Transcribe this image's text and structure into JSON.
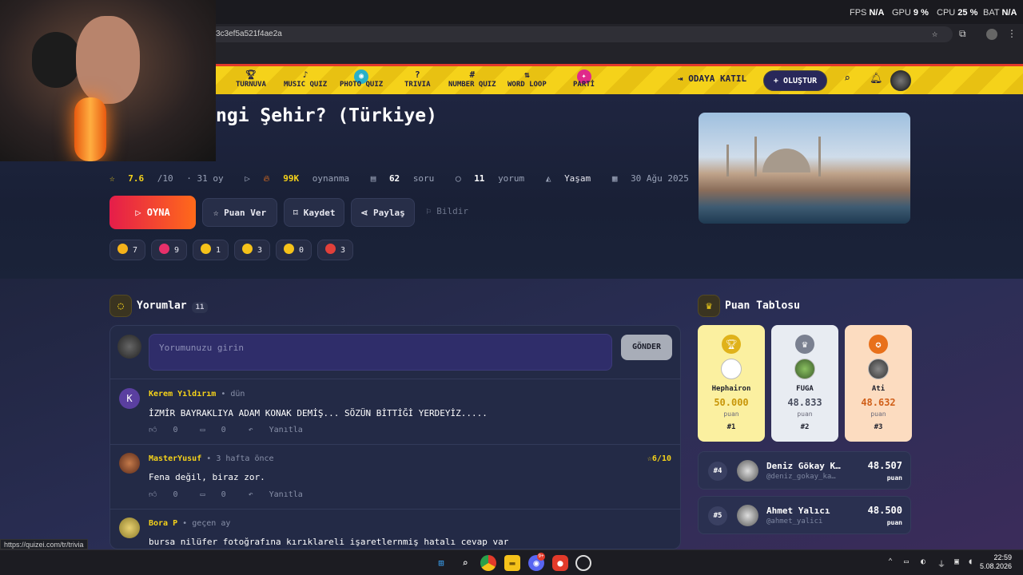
{
  "system_overlay": {
    "fps_label": "FPS",
    "fps_value": "N/A",
    "gpu_label": "GPU",
    "gpu_value": "9 %",
    "cpu_label": "CPU",
    "cpu_value": "25 %",
    "bat_label": "BAT",
    "bat_value": "N/A"
  },
  "browser": {
    "url_fragment": "3c3ef5a521f4ae2a",
    "status_url": "https://quizei.com/tr/trivia"
  },
  "navbar": {
    "items": [
      {
        "label": "TURNUVA",
        "icon": "trophy-icon"
      },
      {
        "label": "MUSIC QUIZ",
        "icon": "music-note-icon"
      },
      {
        "label": "PHOTO QUIZ",
        "icon": "camera-icon"
      },
      {
        "label": "TRIVIA",
        "icon": "question-bubble-icon"
      },
      {
        "label": "NUMBER QUIZ",
        "icon": "hash-icon"
      },
      {
        "label": "WORD LOOP",
        "icon": "sort-icon"
      },
      {
        "label": "PARTİ",
        "icon": "party-icon"
      }
    ],
    "join_label": "ODAYA KATIL",
    "create_label": "+ OLUŞTUR"
  },
  "quiz": {
    "title": "ngi Şehir? (Türkiye)",
    "rating": "7.6",
    "rating_max": "/10",
    "rating_age": "31 oy",
    "plays": "99K",
    "plays_label": "oynanma",
    "questions": "62",
    "questions_label": "soru",
    "comments": "11",
    "comments_label": "yorum",
    "category": "Yaşam",
    "date": "30 Ağu 2025"
  },
  "actions": {
    "play": "OYNA",
    "rate": "Puan Ver",
    "save": "Kaydet",
    "share": "Paylaş",
    "report": "Bildir"
  },
  "reactions": [
    {
      "icon": "thumbs-up-icon",
      "count": "7",
      "color": "#f5b21a"
    },
    {
      "icon": "heart-icon",
      "count": "9",
      "color": "#e8306a"
    },
    {
      "icon": "laugh-icon",
      "count": "1",
      "color": "#f5c21a"
    },
    {
      "icon": "surprised-icon",
      "count": "3",
      "color": "#f5c21a"
    },
    {
      "icon": "sad-icon",
      "count": "0",
      "color": "#f5c21a"
    },
    {
      "icon": "angry-icon",
      "count": "3",
      "color": "#e2403a"
    }
  ],
  "comments_section": {
    "title": "Yorumlar",
    "count": "11",
    "placeholder": "Yorumunuzu girin",
    "send": "GÖNDER",
    "items": [
      {
        "name": "Kerem Yıldırım",
        "time": "dün",
        "text": "İZMİR BAYRAKLIYA ADAM KONAK DEMİŞ... SÖZÜN BİTTİĞİ YERDEYİZ.....",
        "likes": "0",
        "replies": "0",
        "reply_label": "Yanıtla",
        "initial": "K",
        "score": ""
      },
      {
        "name": "MasterYusuf",
        "time": "3 hafta önce",
        "text": "Fena değil, biraz zor.",
        "likes": "0",
        "replies": "0",
        "reply_label": "Yanıtla",
        "initial": "",
        "score": "6/10"
      },
      {
        "name": "Bora P",
        "time": "geçen ay",
        "text": "bursa nilüfer fotoğrafına kırıklareli işaretlernmiş hatalı cevap var",
        "likes": "",
        "replies": "",
        "reply_label": "",
        "initial": "",
        "score": ""
      }
    ]
  },
  "leaderboard": {
    "title": "Puan Tablosu",
    "podium": [
      {
        "name": "Hephairon",
        "score": "50.000",
        "unit": "puan",
        "rank": "#1"
      },
      {
        "name": "FUGA",
        "score": "48.833",
        "unit": "puan",
        "rank": "#2"
      },
      {
        "name": "Ati",
        "score": "48.632",
        "unit": "puan",
        "rank": "#3"
      }
    ],
    "rows": [
      {
        "rank": "#4",
        "name": "Deniz Gökay K…",
        "handle": "@deniz_gokay_ka…",
        "score": "48.507",
        "unit": "puan"
      },
      {
        "rank": "#5",
        "name": "Ahmet Yalıcı",
        "handle": "@ahmet_yalici",
        "score": "48.500",
        "unit": "puan"
      }
    ]
  },
  "taskbar": {
    "time": "22:59",
    "date": "5.08.2026",
    "badge": "9+"
  }
}
